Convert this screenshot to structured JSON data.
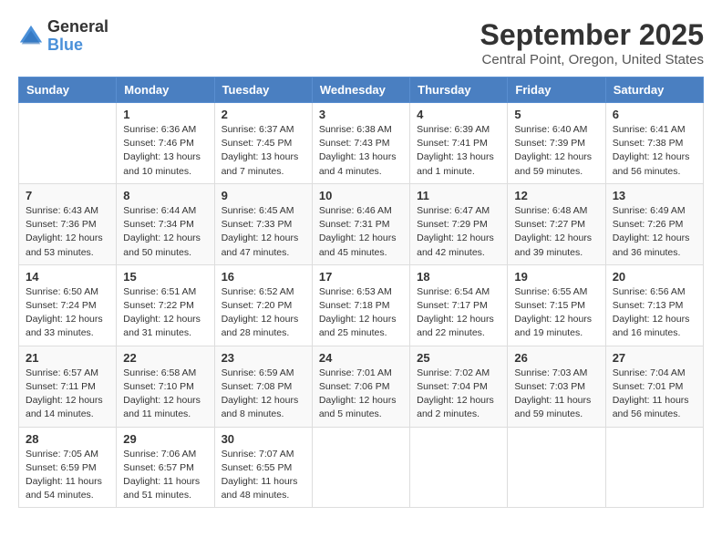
{
  "logo": {
    "general": "General",
    "blue": "Blue"
  },
  "title": "September 2025",
  "subtitle": "Central Point, Oregon, United States",
  "weekdays": [
    "Sunday",
    "Monday",
    "Tuesday",
    "Wednesday",
    "Thursday",
    "Friday",
    "Saturday"
  ],
  "weeks": [
    [
      {
        "day": "",
        "sunrise": "",
        "sunset": "",
        "daylight": ""
      },
      {
        "day": "1",
        "sunrise": "Sunrise: 6:36 AM",
        "sunset": "Sunset: 7:46 PM",
        "daylight": "Daylight: 13 hours and 10 minutes."
      },
      {
        "day": "2",
        "sunrise": "Sunrise: 6:37 AM",
        "sunset": "Sunset: 7:45 PM",
        "daylight": "Daylight: 13 hours and 7 minutes."
      },
      {
        "day": "3",
        "sunrise": "Sunrise: 6:38 AM",
        "sunset": "Sunset: 7:43 PM",
        "daylight": "Daylight: 13 hours and 4 minutes."
      },
      {
        "day": "4",
        "sunrise": "Sunrise: 6:39 AM",
        "sunset": "Sunset: 7:41 PM",
        "daylight": "Daylight: 13 hours and 1 minute."
      },
      {
        "day": "5",
        "sunrise": "Sunrise: 6:40 AM",
        "sunset": "Sunset: 7:39 PM",
        "daylight": "Daylight: 12 hours and 59 minutes."
      },
      {
        "day": "6",
        "sunrise": "Sunrise: 6:41 AM",
        "sunset": "Sunset: 7:38 PM",
        "daylight": "Daylight: 12 hours and 56 minutes."
      }
    ],
    [
      {
        "day": "7",
        "sunrise": "Sunrise: 6:43 AM",
        "sunset": "Sunset: 7:36 PM",
        "daylight": "Daylight: 12 hours and 53 minutes."
      },
      {
        "day": "8",
        "sunrise": "Sunrise: 6:44 AM",
        "sunset": "Sunset: 7:34 PM",
        "daylight": "Daylight: 12 hours and 50 minutes."
      },
      {
        "day": "9",
        "sunrise": "Sunrise: 6:45 AM",
        "sunset": "Sunset: 7:33 PM",
        "daylight": "Daylight: 12 hours and 47 minutes."
      },
      {
        "day": "10",
        "sunrise": "Sunrise: 6:46 AM",
        "sunset": "Sunset: 7:31 PM",
        "daylight": "Daylight: 12 hours and 45 minutes."
      },
      {
        "day": "11",
        "sunrise": "Sunrise: 6:47 AM",
        "sunset": "Sunset: 7:29 PM",
        "daylight": "Daylight: 12 hours and 42 minutes."
      },
      {
        "day": "12",
        "sunrise": "Sunrise: 6:48 AM",
        "sunset": "Sunset: 7:27 PM",
        "daylight": "Daylight: 12 hours and 39 minutes."
      },
      {
        "day": "13",
        "sunrise": "Sunrise: 6:49 AM",
        "sunset": "Sunset: 7:26 PM",
        "daylight": "Daylight: 12 hours and 36 minutes."
      }
    ],
    [
      {
        "day": "14",
        "sunrise": "Sunrise: 6:50 AM",
        "sunset": "Sunset: 7:24 PM",
        "daylight": "Daylight: 12 hours and 33 minutes."
      },
      {
        "day": "15",
        "sunrise": "Sunrise: 6:51 AM",
        "sunset": "Sunset: 7:22 PM",
        "daylight": "Daylight: 12 hours and 31 minutes."
      },
      {
        "day": "16",
        "sunrise": "Sunrise: 6:52 AM",
        "sunset": "Sunset: 7:20 PM",
        "daylight": "Daylight: 12 hours and 28 minutes."
      },
      {
        "day": "17",
        "sunrise": "Sunrise: 6:53 AM",
        "sunset": "Sunset: 7:18 PM",
        "daylight": "Daylight: 12 hours and 25 minutes."
      },
      {
        "day": "18",
        "sunrise": "Sunrise: 6:54 AM",
        "sunset": "Sunset: 7:17 PM",
        "daylight": "Daylight: 12 hours and 22 minutes."
      },
      {
        "day": "19",
        "sunrise": "Sunrise: 6:55 AM",
        "sunset": "Sunset: 7:15 PM",
        "daylight": "Daylight: 12 hours and 19 minutes."
      },
      {
        "day": "20",
        "sunrise": "Sunrise: 6:56 AM",
        "sunset": "Sunset: 7:13 PM",
        "daylight": "Daylight: 12 hours and 16 minutes."
      }
    ],
    [
      {
        "day": "21",
        "sunrise": "Sunrise: 6:57 AM",
        "sunset": "Sunset: 7:11 PM",
        "daylight": "Daylight: 12 hours and 14 minutes."
      },
      {
        "day": "22",
        "sunrise": "Sunrise: 6:58 AM",
        "sunset": "Sunset: 7:10 PM",
        "daylight": "Daylight: 12 hours and 11 minutes."
      },
      {
        "day": "23",
        "sunrise": "Sunrise: 6:59 AM",
        "sunset": "Sunset: 7:08 PM",
        "daylight": "Daylight: 12 hours and 8 minutes."
      },
      {
        "day": "24",
        "sunrise": "Sunrise: 7:01 AM",
        "sunset": "Sunset: 7:06 PM",
        "daylight": "Daylight: 12 hours and 5 minutes."
      },
      {
        "day": "25",
        "sunrise": "Sunrise: 7:02 AM",
        "sunset": "Sunset: 7:04 PM",
        "daylight": "Daylight: 12 hours and 2 minutes."
      },
      {
        "day": "26",
        "sunrise": "Sunrise: 7:03 AM",
        "sunset": "Sunset: 7:03 PM",
        "daylight": "Daylight: 11 hours and 59 minutes."
      },
      {
        "day": "27",
        "sunrise": "Sunrise: 7:04 AM",
        "sunset": "Sunset: 7:01 PM",
        "daylight": "Daylight: 11 hours and 56 minutes."
      }
    ],
    [
      {
        "day": "28",
        "sunrise": "Sunrise: 7:05 AM",
        "sunset": "Sunset: 6:59 PM",
        "daylight": "Daylight: 11 hours and 54 minutes."
      },
      {
        "day": "29",
        "sunrise": "Sunrise: 7:06 AM",
        "sunset": "Sunset: 6:57 PM",
        "daylight": "Daylight: 11 hours and 51 minutes."
      },
      {
        "day": "30",
        "sunrise": "Sunrise: 7:07 AM",
        "sunset": "Sunset: 6:55 PM",
        "daylight": "Daylight: 11 hours and 48 minutes."
      },
      {
        "day": "",
        "sunrise": "",
        "sunset": "",
        "daylight": ""
      },
      {
        "day": "",
        "sunrise": "",
        "sunset": "",
        "daylight": ""
      },
      {
        "day": "",
        "sunrise": "",
        "sunset": "",
        "daylight": ""
      },
      {
        "day": "",
        "sunrise": "",
        "sunset": "",
        "daylight": ""
      }
    ]
  ]
}
